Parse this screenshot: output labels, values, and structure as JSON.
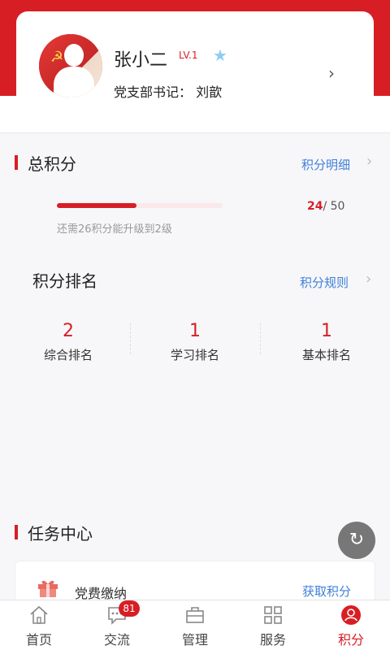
{
  "profile": {
    "name": "张小二",
    "level": "LV.1",
    "role": "党支部书记：  刘歆"
  },
  "total_points": {
    "title": "总积分",
    "detail_link": "积分明细",
    "current": "24",
    "max": "/ 50",
    "progress": 0.48,
    "hint": "还需26积分能升级到2级"
  },
  "ranking": {
    "title": "积分排名",
    "rules_link": "积分规则",
    "items": [
      {
        "value": "2",
        "label": "综合排名"
      },
      {
        "value": "1",
        "label": "学习排名"
      },
      {
        "value": "1",
        "label": "基本排名"
      }
    ]
  },
  "tasks": {
    "title": "任务中心",
    "items": [
      {
        "label": "党费缴纳",
        "action": "获取积分"
      }
    ]
  },
  "tabbar": {
    "items": [
      {
        "label": "首页",
        "icon": "home-icon"
      },
      {
        "label": "交流",
        "icon": "chat-icon",
        "badge": "81"
      },
      {
        "label": "管理",
        "icon": "briefcase-icon"
      },
      {
        "label": "服务",
        "icon": "grid-icon"
      },
      {
        "label": "积分",
        "icon": "user-icon",
        "active": true
      }
    ]
  },
  "colors": {
    "primary": "#d81e25",
    "link": "#3f7fd8"
  }
}
